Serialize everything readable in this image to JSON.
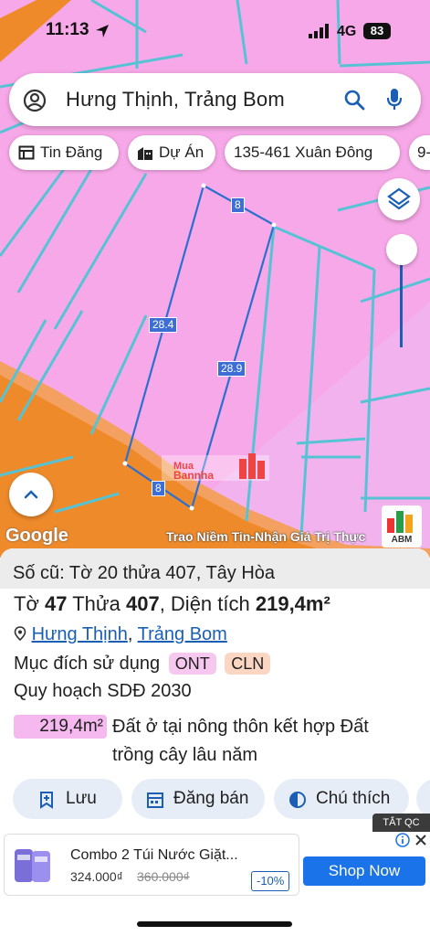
{
  "status_bar": {
    "time": "11:13",
    "network": "4G",
    "battery": "83"
  },
  "search": {
    "query": "Hưng Thịnh, Trảng Bom"
  },
  "chips": [
    {
      "label": "Tin Đăng",
      "icon": "news-icon"
    },
    {
      "label": "Dự Án",
      "icon": "building-icon"
    },
    {
      "label": "135-461 Xuân Đông",
      "icon": ""
    },
    {
      "label": "9-",
      "icon": ""
    }
  ],
  "map": {
    "edge_labels": [
      "8",
      "28.4",
      "28.9",
      "8"
    ],
    "google_logo": "Google",
    "watermark_top": "Mua",
    "watermark_bottom": "Bannha",
    "watermark_slogan": "Trao Niềm Tin-Nhận Giá Trị Thực",
    "abm_label": "ABM",
    "colors": {
      "land_residential": "#f7a8e8",
      "land_perennial": "#f0b8ec",
      "road": "#ec8a2c",
      "parcel_line": "#5fc6d3",
      "selected_line": "#2b6fd1"
    }
  },
  "panel": {
    "old_number": "Số cũ: Tờ 20 thửa 407, Tây Hòa",
    "sheet_word": "Tờ",
    "sheet_no": "47",
    "plot_word": "Thửa",
    "plot_no": "407",
    "area_word": ", Diện tích",
    "area": "219,4m²",
    "location_1": "Hưng Thịnh",
    "location_sep": ",",
    "location_2": "Trảng Bom",
    "purpose_label": "Mục đích sử dụng",
    "purpose_codes": [
      "ONT",
      "CLN"
    ],
    "plan_label": "Quy hoạch SDĐ 2030",
    "plan_area": "219,4m²",
    "plan_desc_1": "Đất ở tại nông thôn kết hợp Đất",
    "plan_desc_2": "trồng cây lâu năm",
    "actions": [
      {
        "label": "Lưu",
        "icon": "bookmark-add-icon"
      },
      {
        "label": "Đăng bán",
        "icon": "calendar-icon"
      },
      {
        "label": "Chú thích",
        "icon": "contrast-icon"
      }
    ]
  },
  "ad": {
    "close_label": "TẮT QC",
    "title": "Combo 2 Túi Nước Giặt...",
    "price": "324.000₫",
    "old_price": "360.000₫",
    "discount": "-10%",
    "cta": "Shop Now"
  }
}
